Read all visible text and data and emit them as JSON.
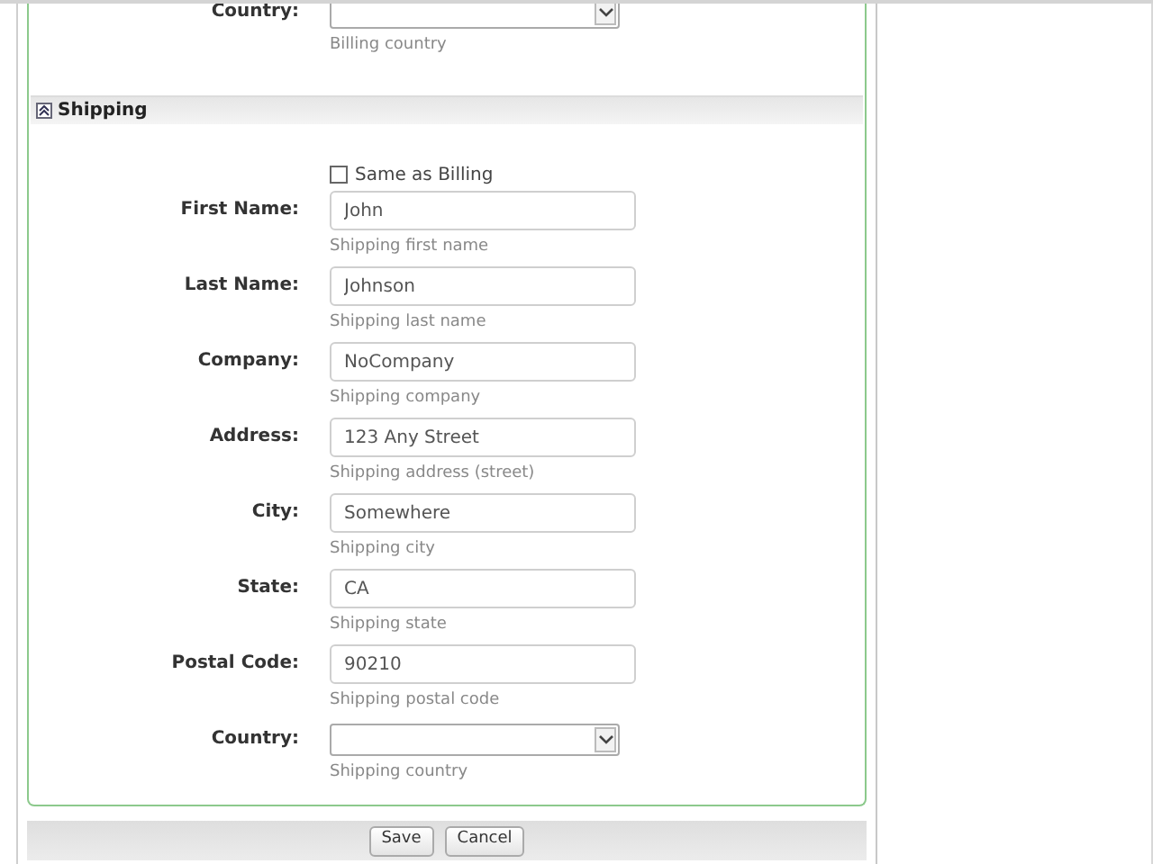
{
  "billing": {
    "fields": [
      {
        "kind": "select",
        "label": "Country:",
        "hint": "Billing country"
      }
    ]
  },
  "shipping": {
    "title": "Shipping",
    "expanded": true,
    "same_as_billing": {
      "label": "Same as Billing",
      "checked": false
    },
    "fields": [
      {
        "kind": "text",
        "label": "First Name:",
        "value": "John",
        "hint": "Shipping first name"
      },
      {
        "kind": "text",
        "label": "Last Name:",
        "value": "Johnson",
        "hint": "Shipping last name"
      },
      {
        "kind": "text",
        "label": "Company:",
        "value": "NoCompany",
        "hint": "Shipping company"
      },
      {
        "kind": "text",
        "label": "Address:",
        "value": "123 Any Street",
        "hint": "Shipping address (street)"
      },
      {
        "kind": "text",
        "label": "City:",
        "value": "Somewhere",
        "hint": "Shipping city"
      },
      {
        "kind": "text",
        "label": "State:",
        "value": "CA",
        "hint": "Shipping state"
      },
      {
        "kind": "text",
        "label": "Postal Code:",
        "value": "90210",
        "hint": "Shipping postal code"
      },
      {
        "kind": "select",
        "label": "Country:",
        "hint": "Shipping country"
      }
    ]
  },
  "buttons": [
    "Save",
    "Cancel"
  ]
}
